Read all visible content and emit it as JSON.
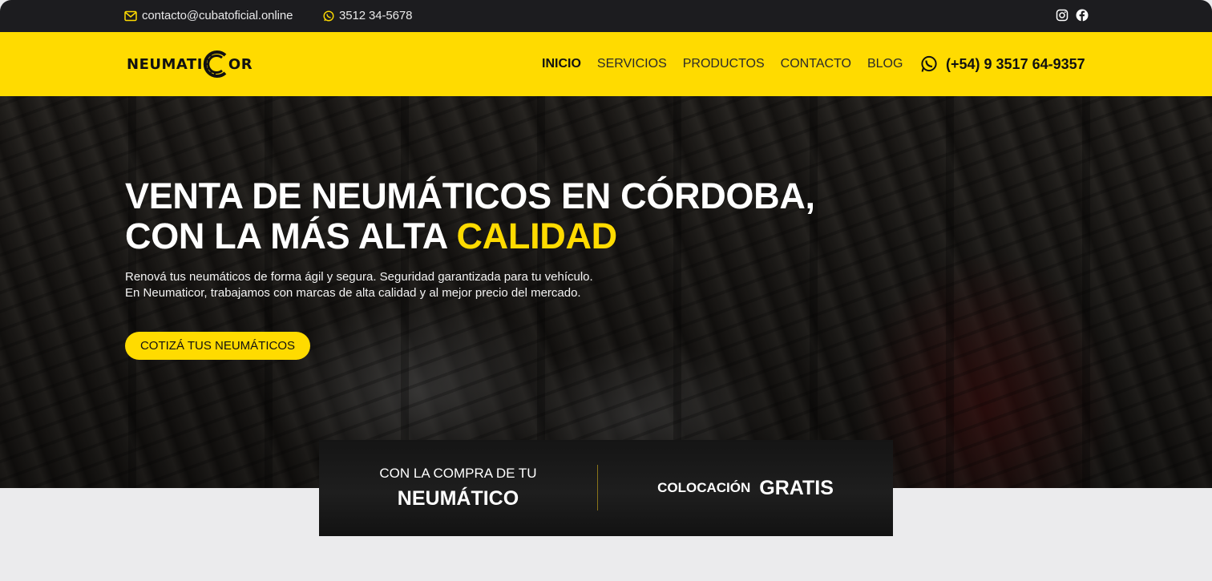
{
  "topbar": {
    "email": "contacto@cubatoficial.online",
    "phone": "3512 34-5678",
    "social_icons": [
      "instagram-icon",
      "facebook-icon"
    ],
    "icon_color": "#ffdb00"
  },
  "brand": {
    "logo_text_left": "NEUMATI",
    "logo_text_right": "OR",
    "logo_icon": "tire-icon",
    "accent_color": "#ffdb00"
  },
  "nav": {
    "items": [
      {
        "label": "INICIO",
        "active": true
      },
      {
        "label": "SERVICIOS",
        "active": false
      },
      {
        "label": "PRODUCTOS",
        "active": false
      },
      {
        "label": "CONTACTO",
        "active": false
      },
      {
        "label": "BLOG",
        "active": false
      }
    ],
    "phone": "(+54) 9 3517 64-9357",
    "phone_icon": "whatsapp-icon"
  },
  "hero": {
    "title_line1": "VENTA DE NEUMÁTICOS EN CÓRDOBA,",
    "title_line2_prefix": "CON LA MÁS ALTA ",
    "title_line2_highlight": "CALIDAD",
    "subtitle_line1": "Renová tus neumáticos de forma ágil y segura. Seguridad garantizada para tu vehículo.",
    "subtitle_line2": "En Neumaticor, trabajamos con marcas de alta calidad y al mejor precio del mercado.",
    "cta_label": "COTIZÁ TUS NEUMÁTICOS"
  },
  "promo": {
    "left_small": "CON LA COMPRA DE TU",
    "left_big": "NEUMÁTICO",
    "right_small": "COLOCACIÓN",
    "right_big": "GRATIS"
  }
}
